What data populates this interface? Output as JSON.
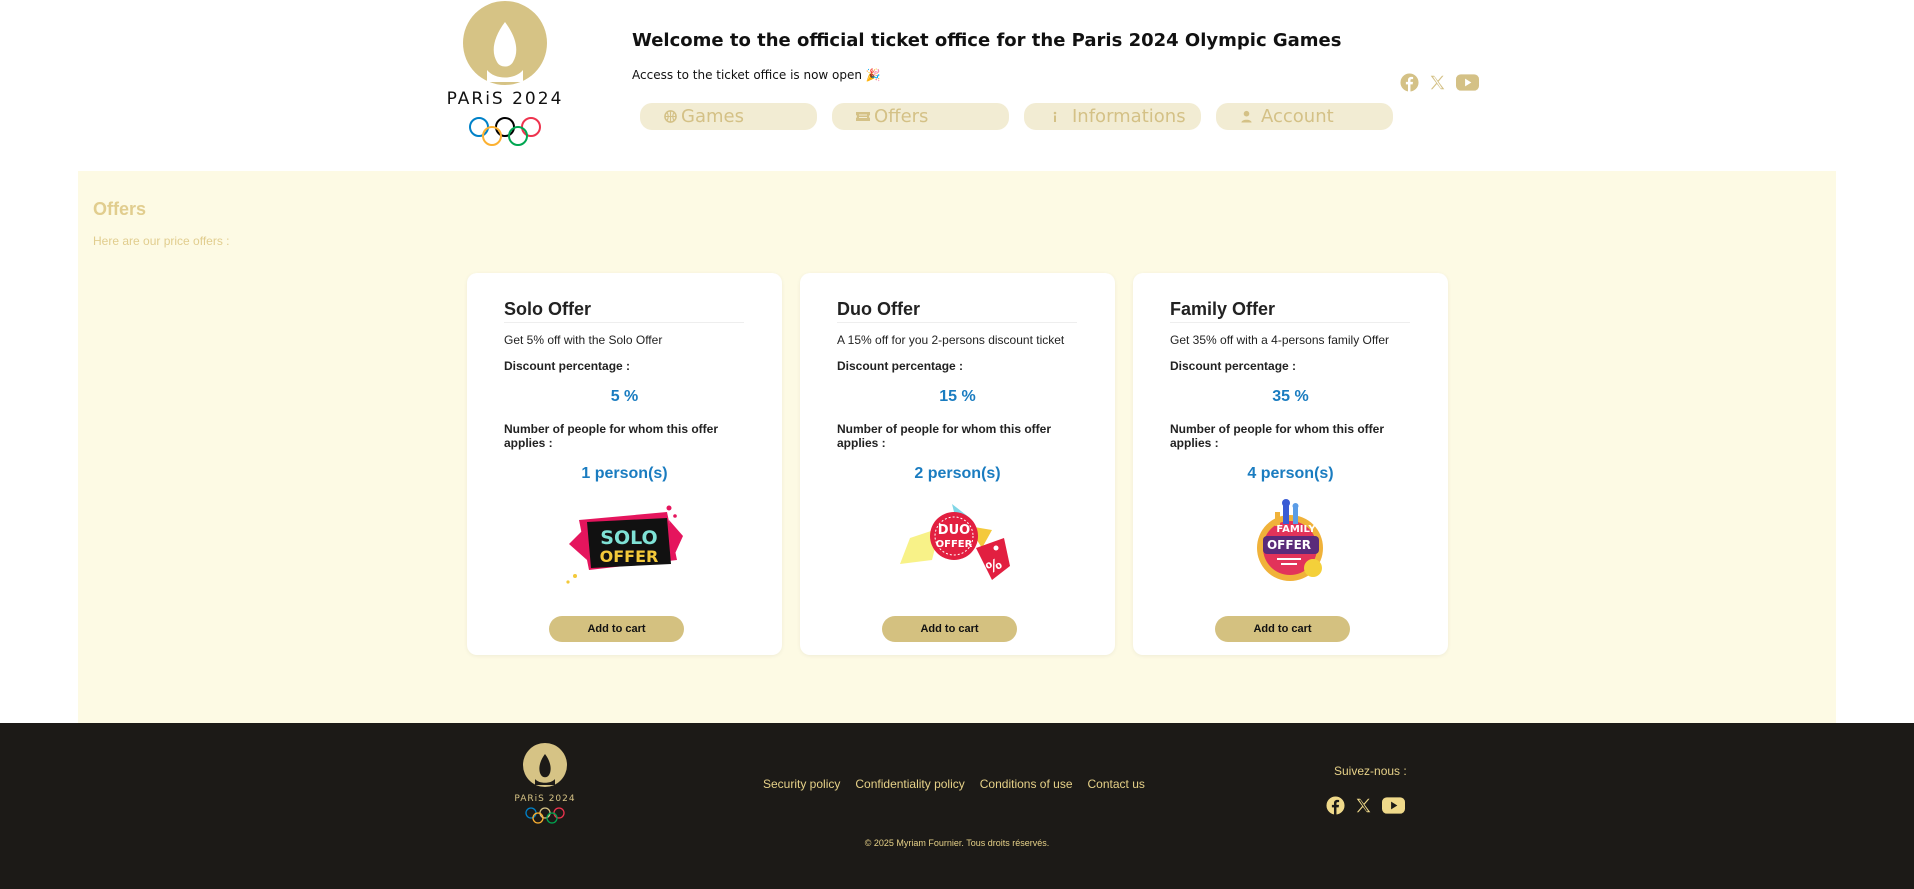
{
  "header": {
    "brand": "PARiS 2024",
    "welcome": "Welcome to the official ticket office for the Paris 2024 Olympic Games",
    "subtitle": "Access to the ticket office is now open 🎉"
  },
  "nav": [
    {
      "label": "Games",
      "icon": "basketball-icon"
    },
    {
      "label": "Offers",
      "icon": "ticket-icon"
    },
    {
      "label": "Informations",
      "icon": "info-icon"
    },
    {
      "label": "Account",
      "icon": "user-icon"
    }
  ],
  "social": [
    "facebook-icon",
    "x-icon",
    "youtube-icon"
  ],
  "main": {
    "title": "Offers",
    "subtitle": "Here are our price offers :",
    "discount_label": "Discount percentage :",
    "people_label": "Number of people for whom this offer applies :",
    "cart_label": "Add to cart",
    "offers": [
      {
        "title": "Solo Offer",
        "description": "Get 5% off with the Solo Offer",
        "discount": "5 %",
        "people": "1 person(s)",
        "badge_line1": "SOLO",
        "badge_line2": "OFFER"
      },
      {
        "title": "Duo Offer",
        "description": "A 15% off for you 2-persons discount ticket",
        "discount": "15 %",
        "people": "2 person(s)",
        "badge_line1": "DUO",
        "badge_line2": "OFFER"
      },
      {
        "title": "Family Offer",
        "description": "Get 35% off with a 4-persons family Offer",
        "discount": "35 %",
        "people": "4 person(s)",
        "badge_line1": "FAMILY",
        "badge_line2": "OFFER"
      }
    ]
  },
  "footer": {
    "brand": "PARiS 2024",
    "links": [
      "Security policy",
      "Confidentiality policy",
      "Conditions of use",
      "Contact us"
    ],
    "follow": "Suivez-nous :",
    "copyright": "© 2025 Myriam Fournier. Tous droits réservés."
  },
  "colors": {
    "gold": "#d4c186",
    "main_bg": "#fdfae4",
    "value_blue": "#1a7cc0",
    "footer_bg": "#1c1a17"
  }
}
